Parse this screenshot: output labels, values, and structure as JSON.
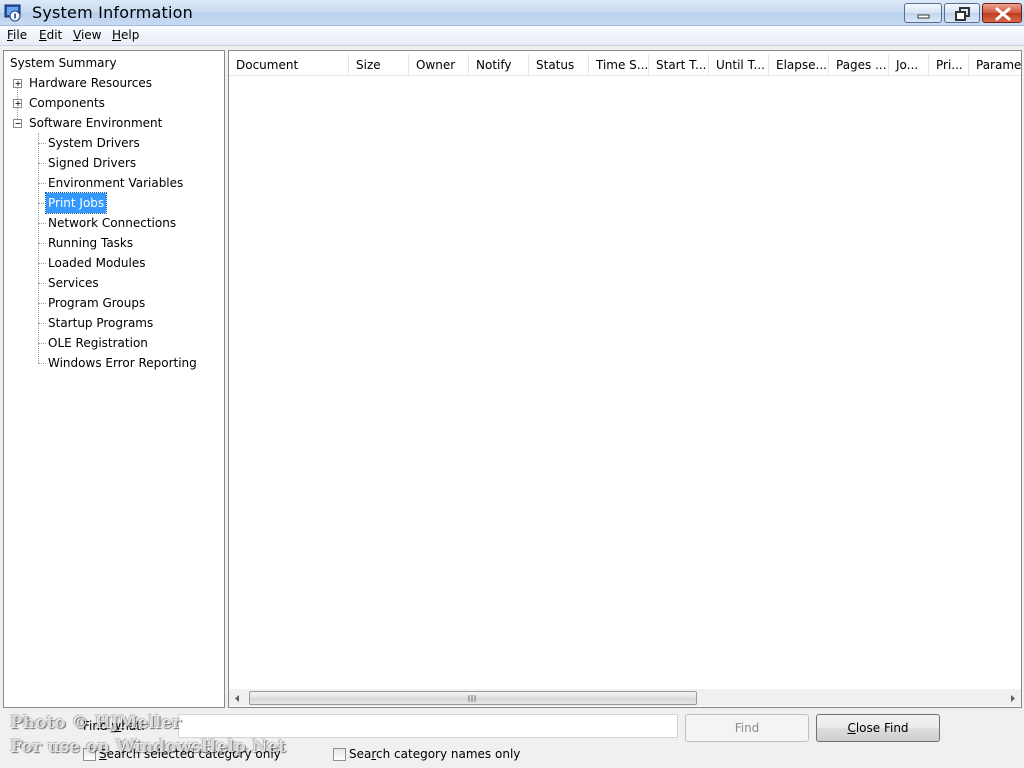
{
  "window": {
    "title": "System Information",
    "icon": "system-information-icon"
  },
  "menu": {
    "items": [
      {
        "label": "File",
        "accel": "F",
        "rest": "ile"
      },
      {
        "label": "Edit",
        "accel": "E",
        "rest": "dit"
      },
      {
        "label": "View",
        "accel": "V",
        "rest": "iew"
      },
      {
        "label": "Help",
        "accel": "H",
        "rest": "elp"
      }
    ]
  },
  "tree": {
    "root": "System Summary",
    "nodes": [
      {
        "label": "Hardware Resources",
        "expander": "plus"
      },
      {
        "label": "Components",
        "expander": "plus"
      },
      {
        "label": "Software Environment",
        "expander": "minus"
      }
    ],
    "children": [
      "System Drivers",
      "Signed Drivers",
      "Environment Variables",
      "Print Jobs",
      "Network Connections",
      "Running Tasks",
      "Loaded Modules",
      "Services",
      "Program Groups",
      "Startup Programs",
      "OLE Registration",
      "Windows Error Reporting"
    ],
    "selected": "Print Jobs"
  },
  "list": {
    "columns": [
      "Document",
      "Size",
      "Owner",
      "Notify",
      "Status",
      "Time S...",
      "Start T...",
      "Until T...",
      "Elapse...",
      "Pages ...",
      "Jo...",
      "Pri...",
      "Parame"
    ]
  },
  "find": {
    "label_pre": "Find ",
    "label_accel": "w",
    "label_post": "hat:",
    "input_value": "",
    "find_button": "Find",
    "close_find_pre": "",
    "close_find_accel": "C",
    "close_find_post": "lose Find",
    "chk_selected_pre": "",
    "chk_selected_accel": "S",
    "chk_selected_post": "earch selected category only",
    "chk_names_pre": "Sea",
    "chk_names_accel": "r",
    "chk_names_post": "ch category names only"
  },
  "watermark": {
    "line1": "Photo © HJMeller",
    "line2": "For use on WindowsHelp.Net"
  },
  "colors": {
    "selection": "#3399ff",
    "close_button": "#c94a2c"
  }
}
